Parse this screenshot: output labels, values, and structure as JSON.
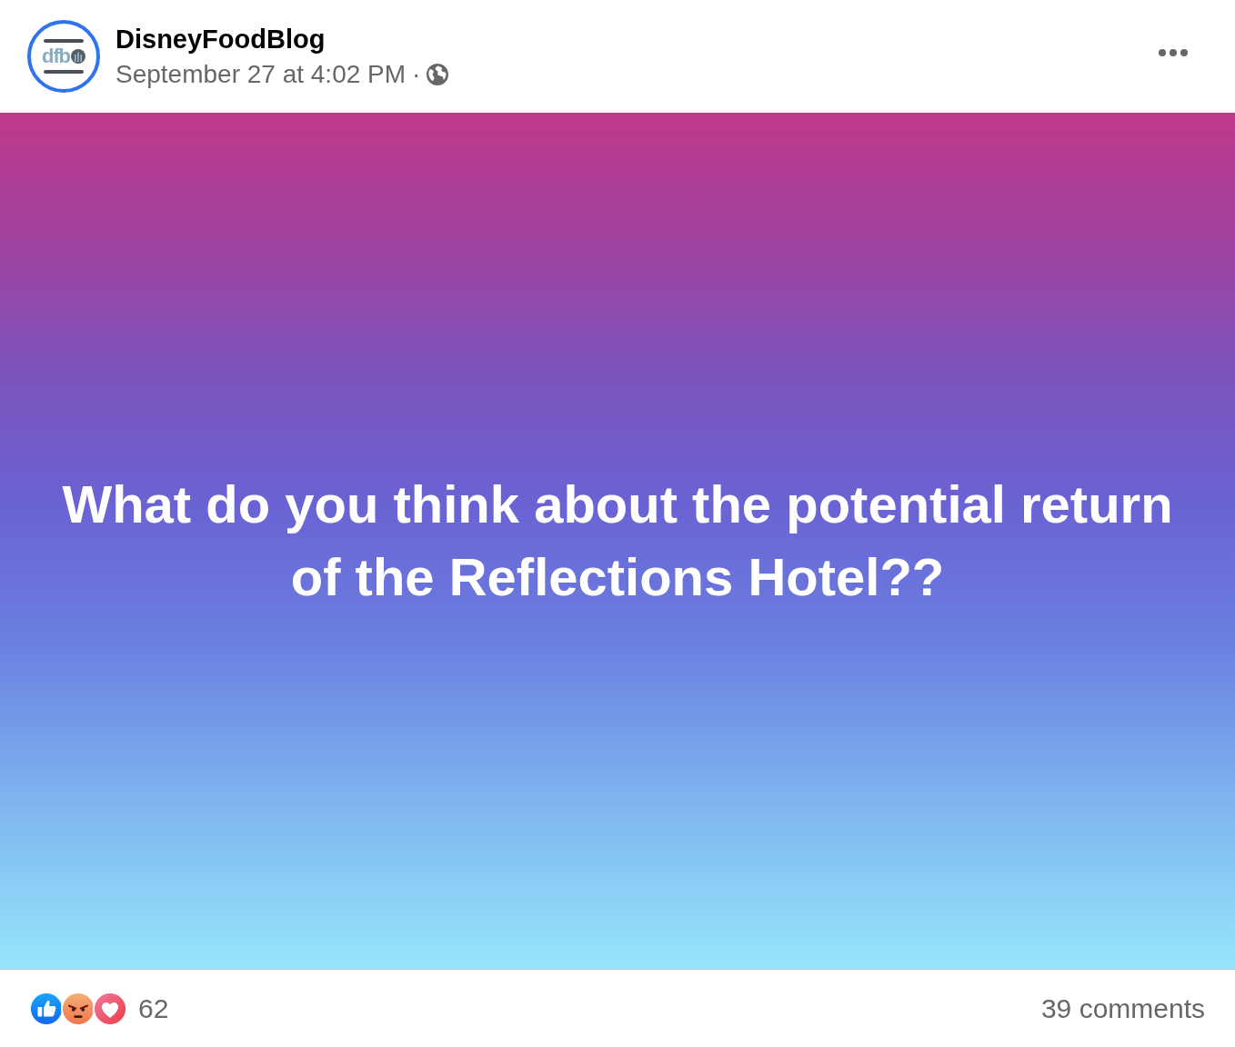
{
  "post": {
    "author": {
      "name": "DisneyFoodBlog",
      "logo_text": "dfb"
    },
    "timestamp": "September 27 at 4:02 PM",
    "separator": "·"
  },
  "banner": {
    "text": "What do you think about the potential return of the Reflections Hotel??"
  },
  "footer": {
    "reactions": [
      {
        "kind": "like"
      },
      {
        "kind": "angry"
      },
      {
        "kind": "love"
      }
    ],
    "reaction_count": "62",
    "comments": "39 comments"
  }
}
